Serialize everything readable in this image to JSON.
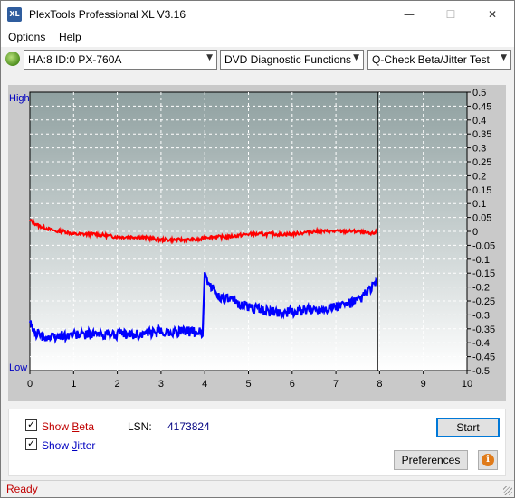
{
  "window": {
    "title": "PlexTools Professional XL V3.16",
    "icon_text": "XL",
    "controls": {
      "minimize": "—",
      "maximize": "☐",
      "close": "✕"
    }
  },
  "menu": {
    "options": "Options",
    "help": "Help"
  },
  "toolbar": {
    "drive": "HA:8 ID:0  PX-760A",
    "function": "DVD Diagnostic Functions",
    "test": "Q-Check Beta/Jitter Test",
    "drive_icon": "disc-icon"
  },
  "chart_data": {
    "type": "line",
    "y_left_labels": {
      "top": "High",
      "bottom": "Low"
    },
    "x_ticks": [
      "0",
      "1",
      "2",
      "3",
      "4",
      "5",
      "6",
      "7",
      "8",
      "9",
      "10"
    ],
    "y_ticks": [
      "0.5",
      "0.45",
      "0.4",
      "0.35",
      "0.3",
      "0.25",
      "0.2",
      "0.15",
      "0.1",
      "0.05",
      "0",
      "-0.05",
      "-0.1",
      "-0.15",
      "-0.2",
      "-0.25",
      "-0.3",
      "-0.35",
      "-0.4",
      "-0.45",
      "-0.5"
    ],
    "xlim": [
      0,
      10
    ],
    "ylim": [
      -0.5,
      0.5
    ],
    "grid": true,
    "end_marker_x": 7.95,
    "series": [
      {
        "name": "Beta",
        "color": "#ff0000",
        "x": [
          0,
          0.2,
          0.4,
          0.6,
          0.8,
          1.0,
          1.5,
          2.0,
          2.5,
          3.0,
          3.5,
          3.9,
          4.0,
          4.5,
          5.0,
          5.5,
          6.0,
          6.5,
          7.0,
          7.5,
          7.8,
          7.95
        ],
        "y": [
          0.04,
          0.02,
          0.01,
          0.0,
          0.0,
          -0.01,
          -0.01,
          -0.02,
          -0.02,
          -0.03,
          -0.03,
          -0.03,
          -0.02,
          -0.02,
          -0.01,
          -0.01,
          -0.01,
          0.0,
          0.0,
          0.0,
          -0.01,
          0.0
        ]
      },
      {
        "name": "Jitter",
        "color": "#0000ff",
        "x": [
          0,
          0.1,
          0.3,
          0.5,
          1.0,
          1.5,
          2.0,
          2.5,
          3.0,
          3.5,
          3.9,
          3.95,
          4.0,
          4.1,
          4.3,
          4.6,
          5.0,
          5.5,
          6.0,
          6.5,
          7.0,
          7.5,
          7.7,
          7.95
        ],
        "y": [
          -0.33,
          -0.36,
          -0.38,
          -0.38,
          -0.37,
          -0.37,
          -0.37,
          -0.37,
          -0.36,
          -0.36,
          -0.36,
          -0.37,
          -0.15,
          -0.19,
          -0.23,
          -0.25,
          -0.27,
          -0.29,
          -0.29,
          -0.28,
          -0.27,
          -0.25,
          -0.22,
          -0.18
        ]
      }
    ]
  },
  "options": {
    "show_beta": "Show Beta",
    "show_beta_accel": "B",
    "show_jitter": "Show Jitter",
    "show_jitter_accel": "J",
    "beta_color": "#c00000",
    "jitter_color": "#0000c0",
    "lsn_label": "LSN:",
    "lsn_value": "4173824"
  },
  "buttons": {
    "start": "Start",
    "preferences": "Preferences",
    "info_icon": "info-icon"
  },
  "status": {
    "text": "Ready"
  }
}
